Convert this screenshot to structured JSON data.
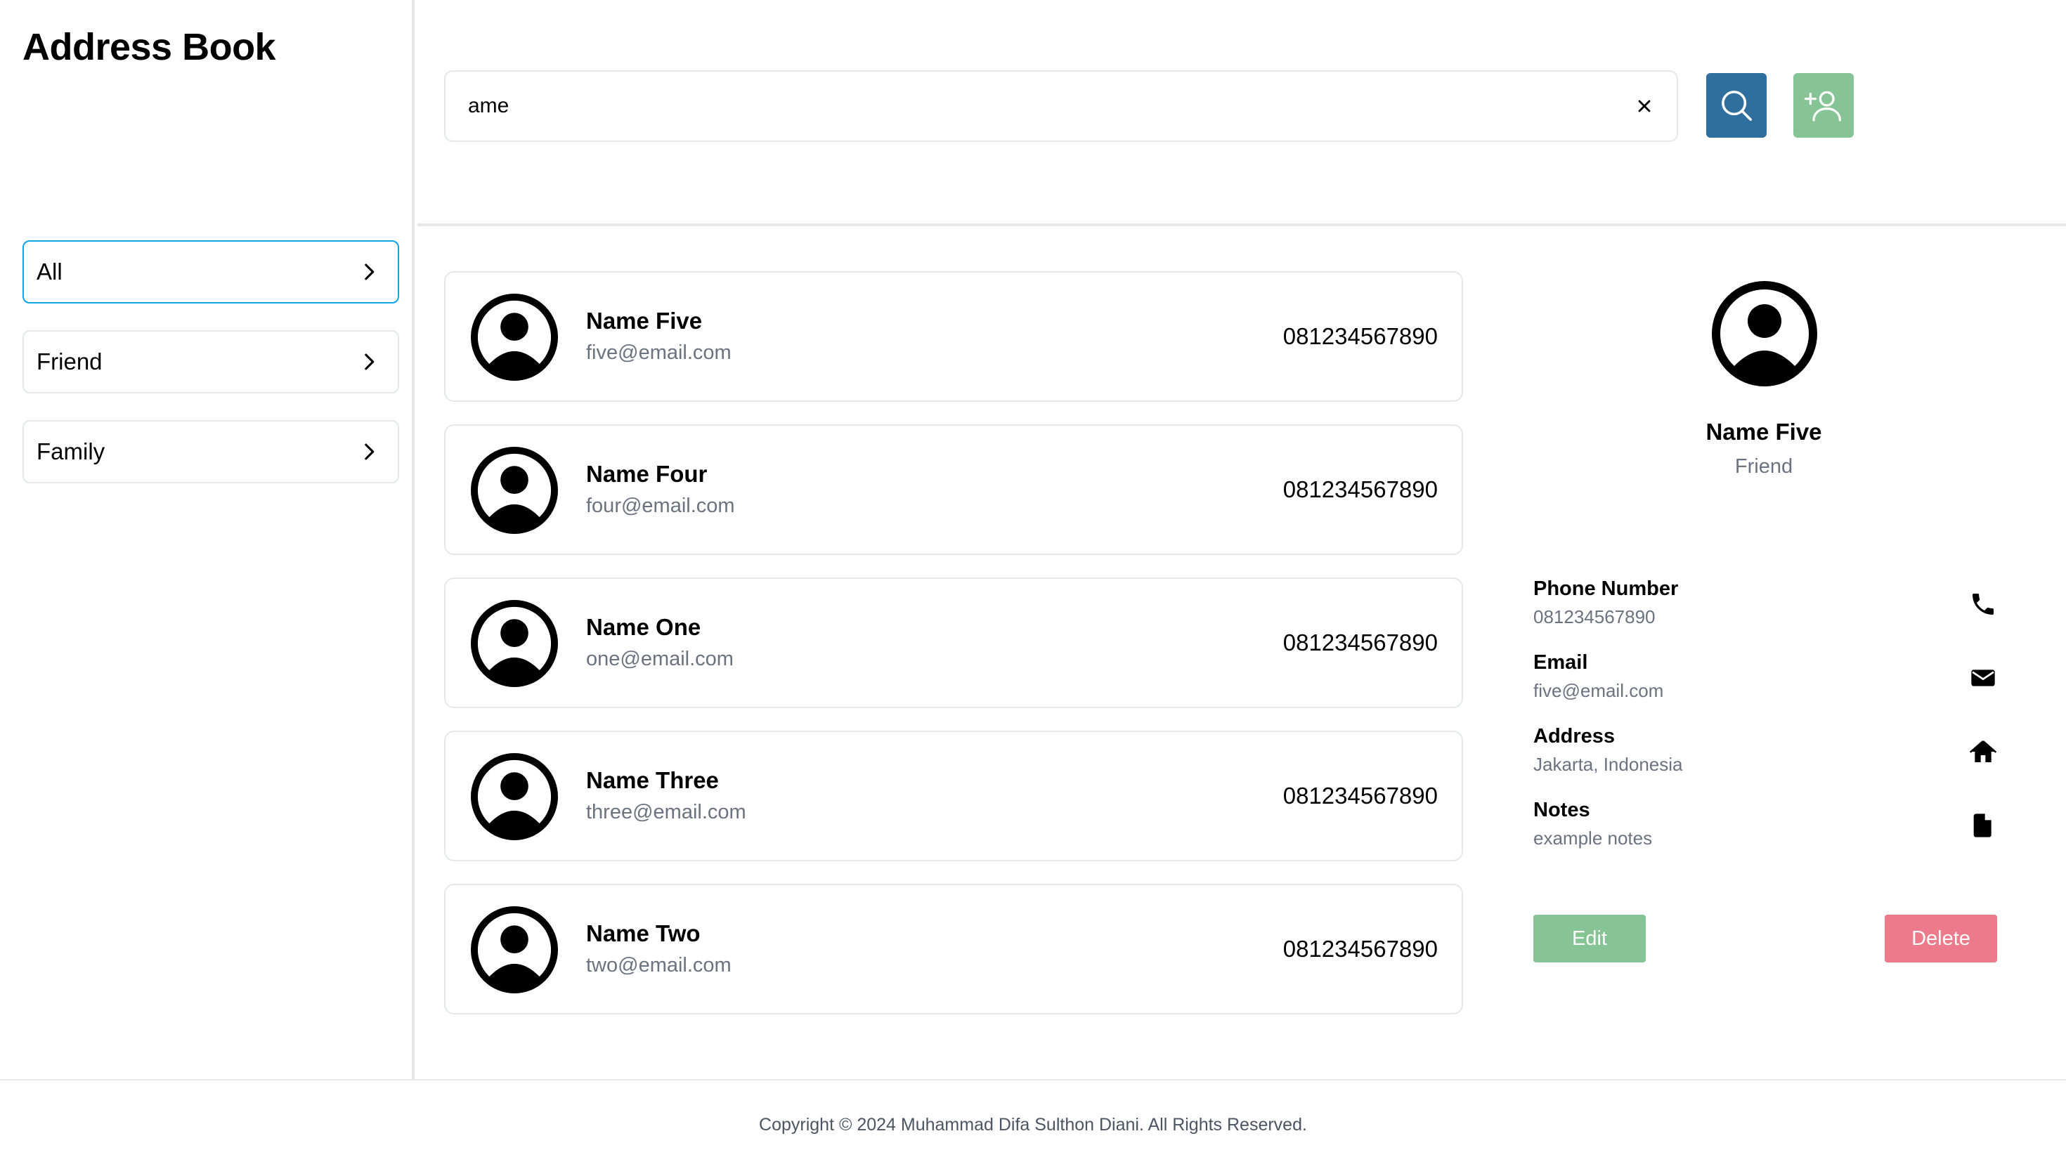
{
  "app": {
    "title": "Address Book"
  },
  "sidebar": {
    "items": [
      {
        "label": "All",
        "active": true
      },
      {
        "label": "Friend",
        "active": false
      },
      {
        "label": "Family",
        "active": false
      }
    ]
  },
  "search": {
    "value": "ame",
    "clear_icon": "close-icon",
    "search_icon": "search-icon",
    "add_icon": "add-user-icon"
  },
  "colors": {
    "search_button": "#2e6f9e",
    "add_button": "#86c495",
    "edit_button": "#86c495",
    "delete_button": "#ec7a8b",
    "active_border": "#0ea5e9"
  },
  "contacts": [
    {
      "name": "Name Five",
      "email": "five@email.com",
      "phone": "081234567890"
    },
    {
      "name": "Name Four",
      "email": "four@email.com",
      "phone": "081234567890"
    },
    {
      "name": "Name One",
      "email": "one@email.com",
      "phone": "081234567890"
    },
    {
      "name": "Name Three",
      "email": "three@email.com",
      "phone": "081234567890"
    },
    {
      "name": "Name Two",
      "email": "two@email.com",
      "phone": "081234567890"
    }
  ],
  "detail": {
    "name": "Name Five",
    "group": "Friend",
    "fields": [
      {
        "label": "Phone Number",
        "value": "081234567890",
        "icon": "phone-icon"
      },
      {
        "label": "Email",
        "value": "five@email.com",
        "icon": "envelope-icon"
      },
      {
        "label": "Address",
        "value": "Jakarta, Indonesia",
        "icon": "home-icon"
      },
      {
        "label": "Notes",
        "value": "example notes",
        "icon": "document-icon"
      }
    ],
    "edit_label": "Edit",
    "delete_label": "Delete"
  },
  "footer": {
    "text": "Copyright © 2024 Muhammad Difa Sulthon Diani. All Rights Reserved."
  }
}
